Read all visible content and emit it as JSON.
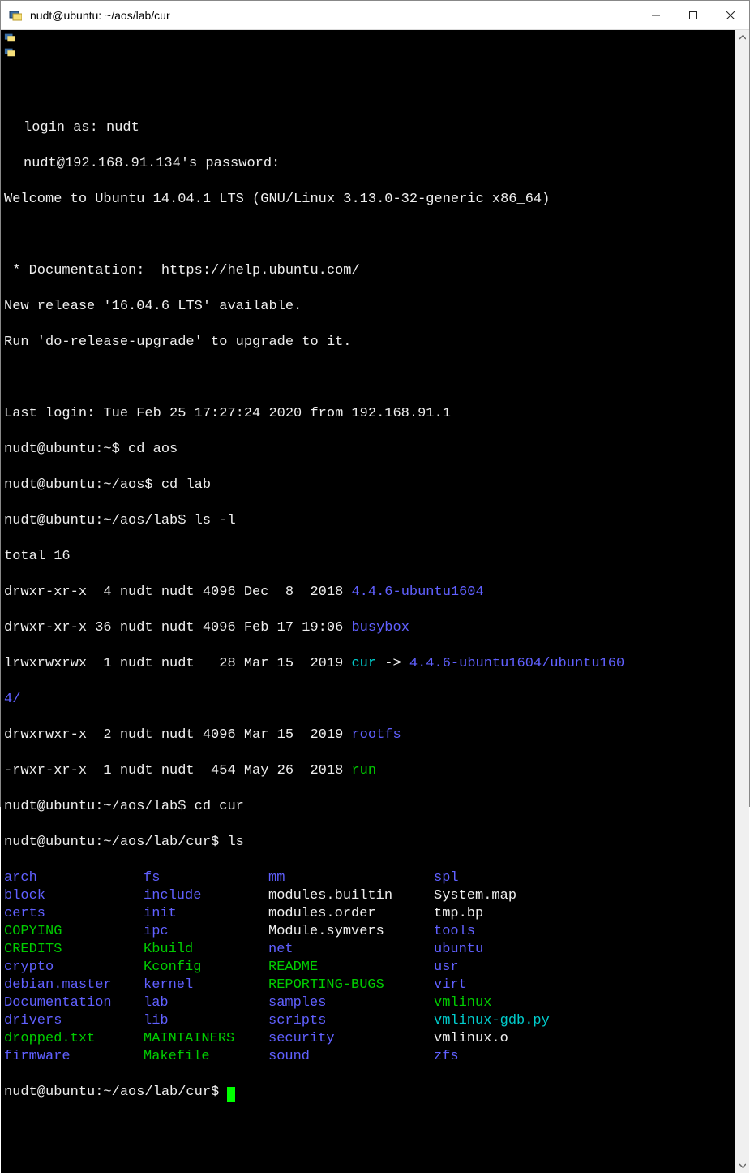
{
  "window": {
    "title": "nudt@ubuntu: ~/aos/lab/cur"
  },
  "session": {
    "login_prompt": "login as: nudt",
    "password_prompt": "nudt@192.168.91.134's password:",
    "welcome": "Welcome to Ubuntu 14.04.1 LTS (GNU/Linux 3.13.0-32-generic x86_64)",
    "doc_line": " * Documentation:  https://help.ubuntu.com/",
    "new_release": "New release '16.04.6 LTS' available.",
    "upgrade_hint": "Run 'do-release-upgrade' to upgrade to it.",
    "last_login": "Last login: Tue Feb 25 17:27:24 2020 from 192.168.91.1"
  },
  "prompts": {
    "home": "nudt@ubuntu:~$ ",
    "aos": "nudt@ubuntu:~/aos$ ",
    "lab": "nudt@ubuntu:~/aos/lab$ ",
    "cur": "nudt@ubuntu:~/aos/lab/cur$ "
  },
  "cmds": {
    "cd_aos": "cd aos",
    "cd_lab": "cd lab",
    "ls_l": "ls -l",
    "cd_cur": "cd cur",
    "ls": "ls"
  },
  "lsl": {
    "total": "total 16",
    "e0": {
      "perm": "drwxr-xr-x  4 nudt nudt 4096 Dec  8  2018 ",
      "name": "4.4.6-ubuntu1604"
    },
    "e1": {
      "perm": "drwxr-xr-x 36 nudt nudt 4096 Feb 17 19:06 ",
      "name": "busybox"
    },
    "e2": {
      "perm": "lrwxrwxrwx  1 nudt nudt   28 Mar 15  2019 ",
      "name": "cur",
      "arrow": " -> ",
      "target": "4.4.6-ubuntu1604/ubuntu160",
      "target2": "4/"
    },
    "e3": {
      "perm": "drwxrwxr-x  2 nudt nudt 4096 Mar 15  2019 ",
      "name": "rootfs"
    },
    "e4": {
      "perm": "-rwxr-xr-x  1 nudt nudt  454 May 26  2018 ",
      "name": "run"
    }
  },
  "ls_cols": [
    {
      "c1": {
        "t": "arch",
        "c": "blue"
      },
      "c2": {
        "t": "fs",
        "c": "blue"
      },
      "c3": {
        "t": "mm",
        "c": "blue"
      },
      "c4": {
        "t": "spl",
        "c": "blue"
      }
    },
    {
      "c1": {
        "t": "block",
        "c": "blue"
      },
      "c2": {
        "t": "include",
        "c": "blue"
      },
      "c3": {
        "t": "modules.builtin",
        "c": "white"
      },
      "c4": {
        "t": "System.map",
        "c": "white"
      }
    },
    {
      "c1": {
        "t": "certs",
        "c": "blue"
      },
      "c2": {
        "t": "init",
        "c": "blue"
      },
      "c3": {
        "t": "modules.order",
        "c": "white"
      },
      "c4": {
        "t": "tmp.bp",
        "c": "white"
      }
    },
    {
      "c1": {
        "t": "COPYING",
        "c": "green"
      },
      "c2": {
        "t": "ipc",
        "c": "blue"
      },
      "c3": {
        "t": "Module.symvers",
        "c": "white"
      },
      "c4": {
        "t": "tools",
        "c": "blue"
      }
    },
    {
      "c1": {
        "t": "CREDITS",
        "c": "green"
      },
      "c2": {
        "t": "Kbuild",
        "c": "green"
      },
      "c3": {
        "t": "net",
        "c": "blue"
      },
      "c4": {
        "t": "ubuntu",
        "c": "blue"
      }
    },
    {
      "c1": {
        "t": "crypto",
        "c": "blue"
      },
      "c2": {
        "t": "Kconfig",
        "c": "green"
      },
      "c3": {
        "t": "README",
        "c": "green"
      },
      "c4": {
        "t": "usr",
        "c": "blue"
      }
    },
    {
      "c1": {
        "t": "debian.master",
        "c": "blue"
      },
      "c2": {
        "t": "kernel",
        "c": "blue"
      },
      "c3": {
        "t": "REPORTING-BUGS",
        "c": "green"
      },
      "c4": {
        "t": "virt",
        "c": "blue"
      }
    },
    {
      "c1": {
        "t": "Documentation",
        "c": "blue"
      },
      "c2": {
        "t": "lab",
        "c": "blue"
      },
      "c3": {
        "t": "samples",
        "c": "blue"
      },
      "c4": {
        "t": "vmlinux",
        "c": "green"
      }
    },
    {
      "c1": {
        "t": "drivers",
        "c": "blue"
      },
      "c2": {
        "t": "lib",
        "c": "blue"
      },
      "c3": {
        "t": "scripts",
        "c": "blue"
      },
      "c4": {
        "t": "vmlinux-gdb.py",
        "c": "cyan"
      }
    },
    {
      "c1": {
        "t": "dropped.txt",
        "c": "green"
      },
      "c2": {
        "t": "MAINTAINERS",
        "c": "green"
      },
      "c3": {
        "t": "security",
        "c": "blue"
      },
      "c4": {
        "t": "vmlinux.o",
        "c": "white"
      }
    },
    {
      "c1": {
        "t": "firmware",
        "c": "blue"
      },
      "c2": {
        "t": "Makefile",
        "c": "green"
      },
      "c3": {
        "t": "sound",
        "c": "blue"
      },
      "c4": {
        "t": "zfs",
        "c": "blue"
      }
    }
  ]
}
